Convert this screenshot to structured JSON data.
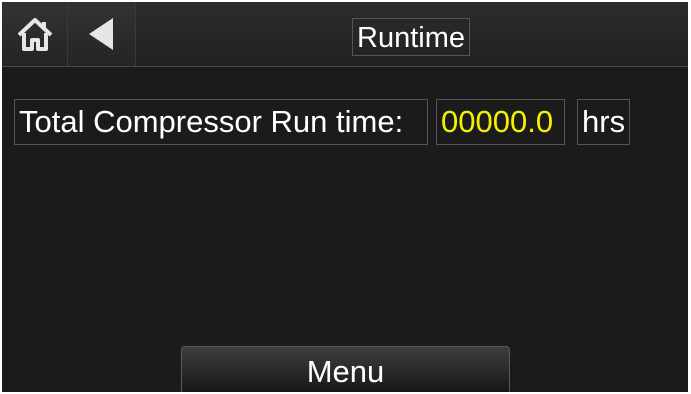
{
  "header": {
    "title": "Runtime",
    "home_icon": "home-icon",
    "back_icon": "back-arrow-icon"
  },
  "runtime": {
    "label": "Total Compressor Run time:",
    "value": "00000.0",
    "unit": "hrs"
  },
  "footer": {
    "menu_label": "Menu"
  },
  "colors": {
    "background": "#1b1b1b",
    "value_text": "#f2f200",
    "text": "#ffffff"
  }
}
